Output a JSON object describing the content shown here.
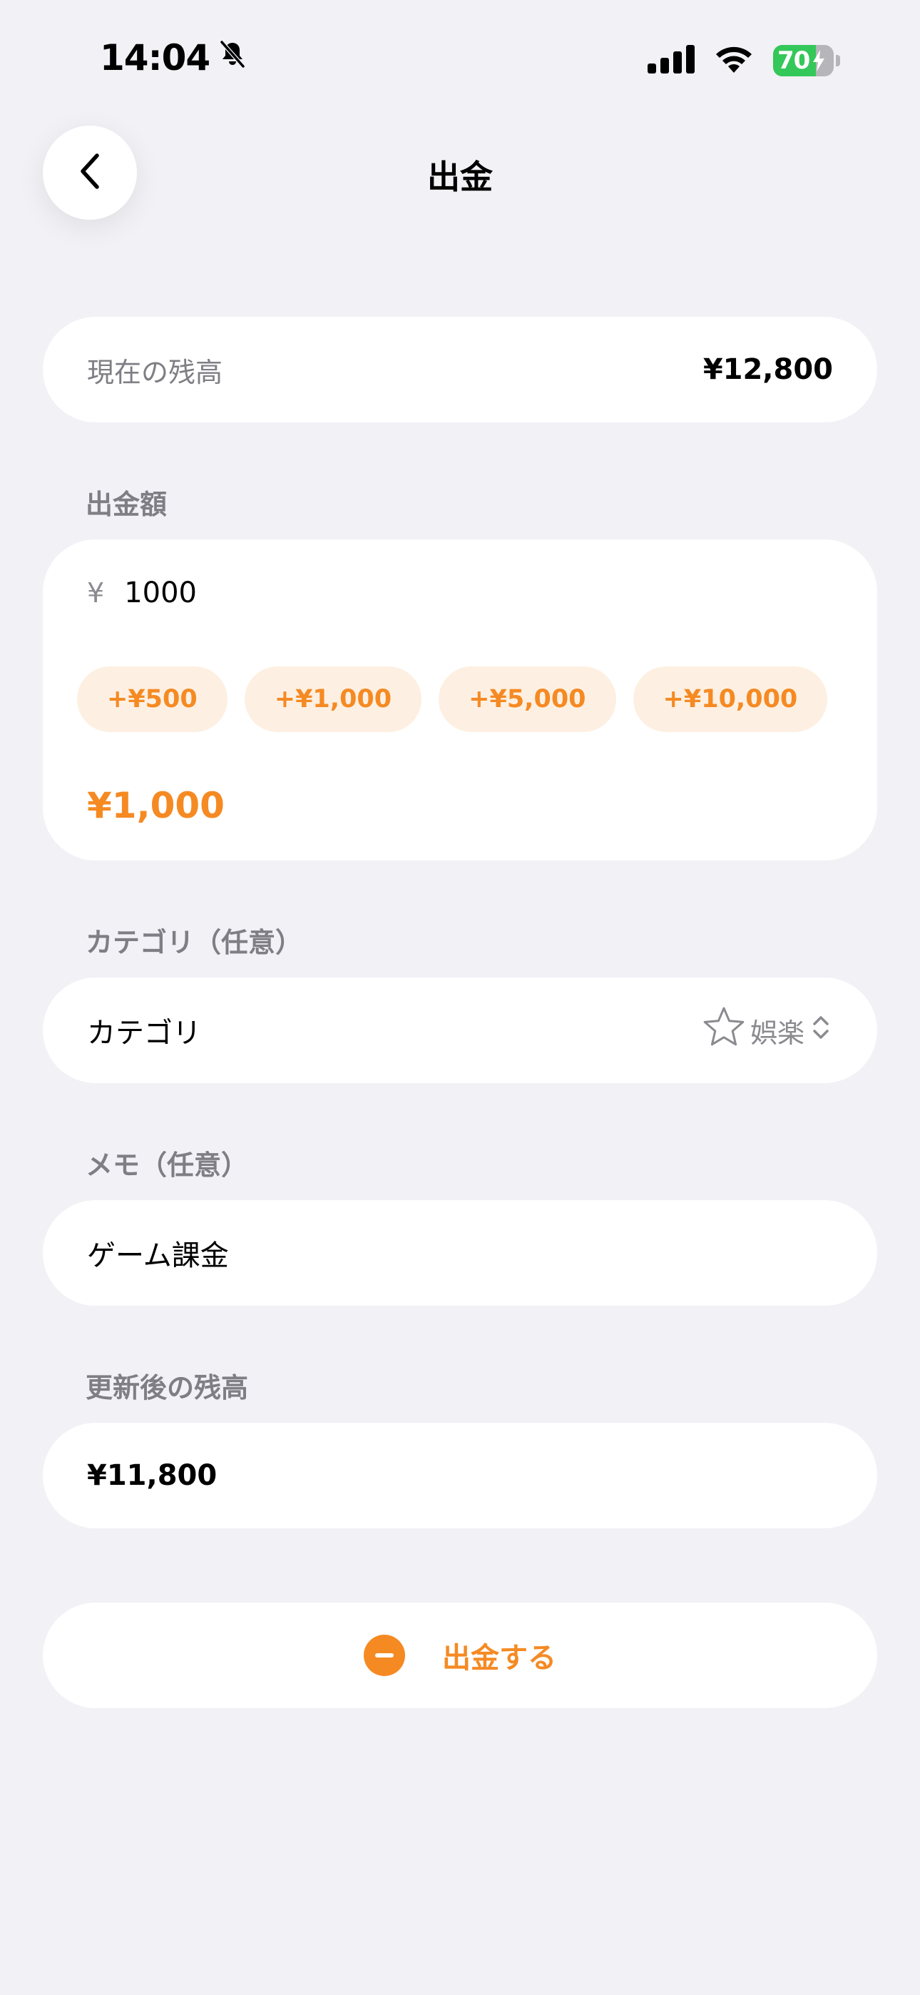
{
  "status_bar": {
    "time": "14:04",
    "battery_percent": 70,
    "battery_label": "70",
    "icons": [
      "bell-slash-icon",
      "cellular-signal-icon",
      "wifi-icon",
      "battery-charging-icon"
    ]
  },
  "nav": {
    "title": "出金",
    "back_icon": "chevron-left-icon"
  },
  "balance": {
    "label": "現在の残高",
    "value": "¥12,800"
  },
  "amount": {
    "section_label": "出金額",
    "currency_prefix": "¥",
    "input_value": "1000",
    "chips": [
      "+¥500",
      "+¥1,000",
      "+¥5,000",
      "+¥10,000"
    ],
    "display": "¥1,000"
  },
  "category": {
    "section_label": "カテゴリ（任意）",
    "row_label": "カテゴリ",
    "selected_icon": "star-icon",
    "selected_value": "娯楽"
  },
  "memo": {
    "section_label": "メモ（任意）",
    "value": "ゲーム課金"
  },
  "after_balance": {
    "section_label": "更新後の残高",
    "value": "¥11,800"
  },
  "action": {
    "icon": "minus-circle-icon",
    "label": "出金する"
  },
  "colors": {
    "accent": "#F58A23",
    "chip_background": "#FDF0E2",
    "page_background": "#F1F1F6",
    "secondary_text": "#7E7E84",
    "battery_green": "#34C759"
  }
}
